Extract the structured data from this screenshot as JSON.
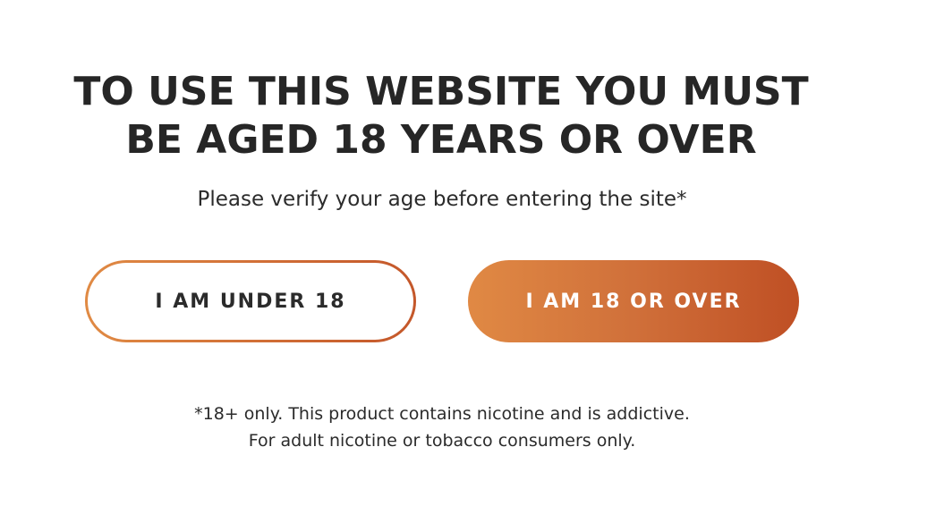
{
  "gate": {
    "headline_line1": "TO USE THIS WEBSITE YOU MUST",
    "headline_line2": "BE AGED 18 YEARS OR OVER",
    "subtitle": "Please verify your age before entering the site*",
    "buttons": {
      "under_label": "I AM UNDER 18",
      "over_label": "I AM 18 OR OVER"
    },
    "disclaimer_line1": "*18+ only. This product contains nicotine and is addictive.",
    "disclaimer_line2": "For adult nicotine or tobacco consumers only."
  },
  "colors": {
    "accent_start": "#e08944",
    "accent_end": "#bf4f24",
    "text": "#262626",
    "background": "#ffffff"
  }
}
